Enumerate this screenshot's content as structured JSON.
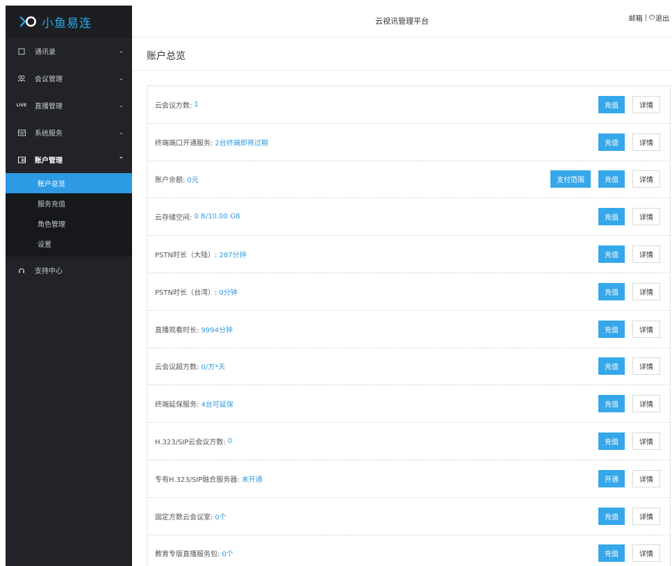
{
  "app": {
    "brand": "小鱼易连",
    "platform_title": "云视讯管理平台",
    "top_links": {
      "mailbox": "邮箱",
      "separator": "|",
      "logout": "退出"
    }
  },
  "sidebar": {
    "items": [
      {
        "icon": "contacts-icon",
        "label": "通讯录",
        "chevron": "⌄"
      },
      {
        "icon": "meeting-icon",
        "label": "会议管理",
        "chevron": "⌄"
      },
      {
        "icon": "live-icon",
        "icon_text": "LIVE",
        "label": "直播管理",
        "chevron": "⌄"
      },
      {
        "icon": "system-icon",
        "label": "系统服务",
        "chevron": "⌄"
      },
      {
        "icon": "account-icon",
        "label": "账户管理",
        "chevron": "⌃"
      }
    ],
    "submenu": [
      {
        "label": "账户总览",
        "selected": true
      },
      {
        "label": "服务充值",
        "selected": false
      },
      {
        "label": "角色管理",
        "selected": false
      },
      {
        "label": "设置",
        "selected": false
      }
    ],
    "support": {
      "icon": "headset-icon",
      "label": "支持中心"
    }
  },
  "main": {
    "page_title": "账户总览",
    "rows": [
      {
        "label": "云会议方数:",
        "value": "1",
        "action": "充值",
        "detail": "详情"
      },
      {
        "label": "终端端口开通服务:",
        "value": "2台终端即将过期",
        "action": "充值",
        "detail": "详情"
      },
      {
        "label": "账户余额:",
        "value": "0元",
        "extra": "支付范围",
        "action": "充值",
        "detail": "详情"
      },
      {
        "label": "云存储空间:",
        "value": "0 B/10.00 GB",
        "action": "充值",
        "detail": "详情"
      },
      {
        "label": "PSTN时长（大陆）:",
        "value": "287分钟",
        "action": "充值",
        "detail": "详情"
      },
      {
        "label": "PSTN时长（台湾）:",
        "value": "0分钟",
        "action": "充值",
        "detail": "详情"
      },
      {
        "label": "直播观看时长:",
        "value": "9994分钟",
        "action": "充值",
        "detail": "详情"
      },
      {
        "label": "云会议超方数:",
        "value": "0/方*天",
        "action": "充值",
        "detail": "详情"
      },
      {
        "label": "终端延保服务:",
        "value": "4台可延保",
        "action": "充值",
        "detail": "详情"
      },
      {
        "label": "H.323/SIP云会议方数:",
        "value": "0",
        "action": "充值",
        "detail": "详情"
      },
      {
        "label": "专有H.323/SIP融合服务器:",
        "value": "未开通",
        "action": "开通",
        "detail": "详情"
      },
      {
        "label": "固定方数云会议室:",
        "value": "0个",
        "action": "充值",
        "detail": "详情"
      },
      {
        "label": "教育专版直播服务包:",
        "value": "0个",
        "action": "充值",
        "detail": "详情"
      }
    ]
  },
  "colors": {
    "sidebar_bg": "#212328",
    "selected_bg": "#2d9be3",
    "brand_blue": "#29a8e6",
    "value_blue": "#2f9be0",
    "button_blue": "#35a7ea"
  }
}
